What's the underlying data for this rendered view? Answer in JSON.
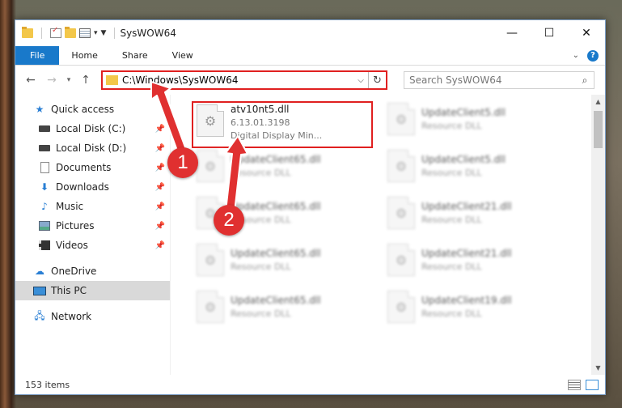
{
  "window": {
    "title": "SysWOW64",
    "controls": {
      "minimize": "—",
      "maximize": "☐",
      "close": "✕"
    }
  },
  "ribbon": {
    "tabs": [
      {
        "label": "File"
      },
      {
        "label": "Home"
      },
      {
        "label": "Share"
      },
      {
        "label": "View"
      }
    ]
  },
  "address_bar": {
    "path": "C:\\Windows\\SysWOW64"
  },
  "search": {
    "placeholder": "Search SysWOW64"
  },
  "nav_pane": {
    "quick_access": "Quick access",
    "items": [
      {
        "label": "Local Disk (C:)",
        "pinned": true
      },
      {
        "label": "Local Disk (D:)",
        "pinned": true
      },
      {
        "label": "Documents",
        "pinned": true
      },
      {
        "label": "Downloads",
        "pinned": true
      },
      {
        "label": "Music",
        "pinned": true
      },
      {
        "label": "Pictures",
        "pinned": true
      },
      {
        "label": "Videos",
        "pinned": true
      }
    ],
    "onedrive": "OneDrive",
    "this_pc": "This PC",
    "network": "Network"
  },
  "files": {
    "selected": {
      "name": "atv10nt5.dll",
      "version": "6.13.01.3198",
      "description": "Digital Display Min..."
    },
    "left_column": [
      {
        "name": "UpdateClient65.dll",
        "type": "Resource DLL"
      },
      {
        "name": "UpdateClient65.dll",
        "type": "Resource DLL"
      },
      {
        "name": "UpdateClient65.dll",
        "type": "Resource DLL"
      },
      {
        "name": "UpdateClient65.dll",
        "type": "Resource DLL"
      }
    ],
    "right_column": [
      {
        "name": "UpdateClient5.dll",
        "type": "Resource DLL"
      },
      {
        "name": "UpdateClient5.dll",
        "type": "Resource DLL"
      },
      {
        "name": "UpdateClient21.dll",
        "type": "Resource DLL"
      },
      {
        "name": "UpdateClient21.dll",
        "type": "Resource DLL"
      },
      {
        "name": "UpdateClient19.dll",
        "type": "Resource DLL"
      }
    ]
  },
  "status": {
    "item_count": "153 items"
  },
  "annotations": {
    "badge_1": "1",
    "badge_2": "2",
    "color": "#e03030"
  }
}
